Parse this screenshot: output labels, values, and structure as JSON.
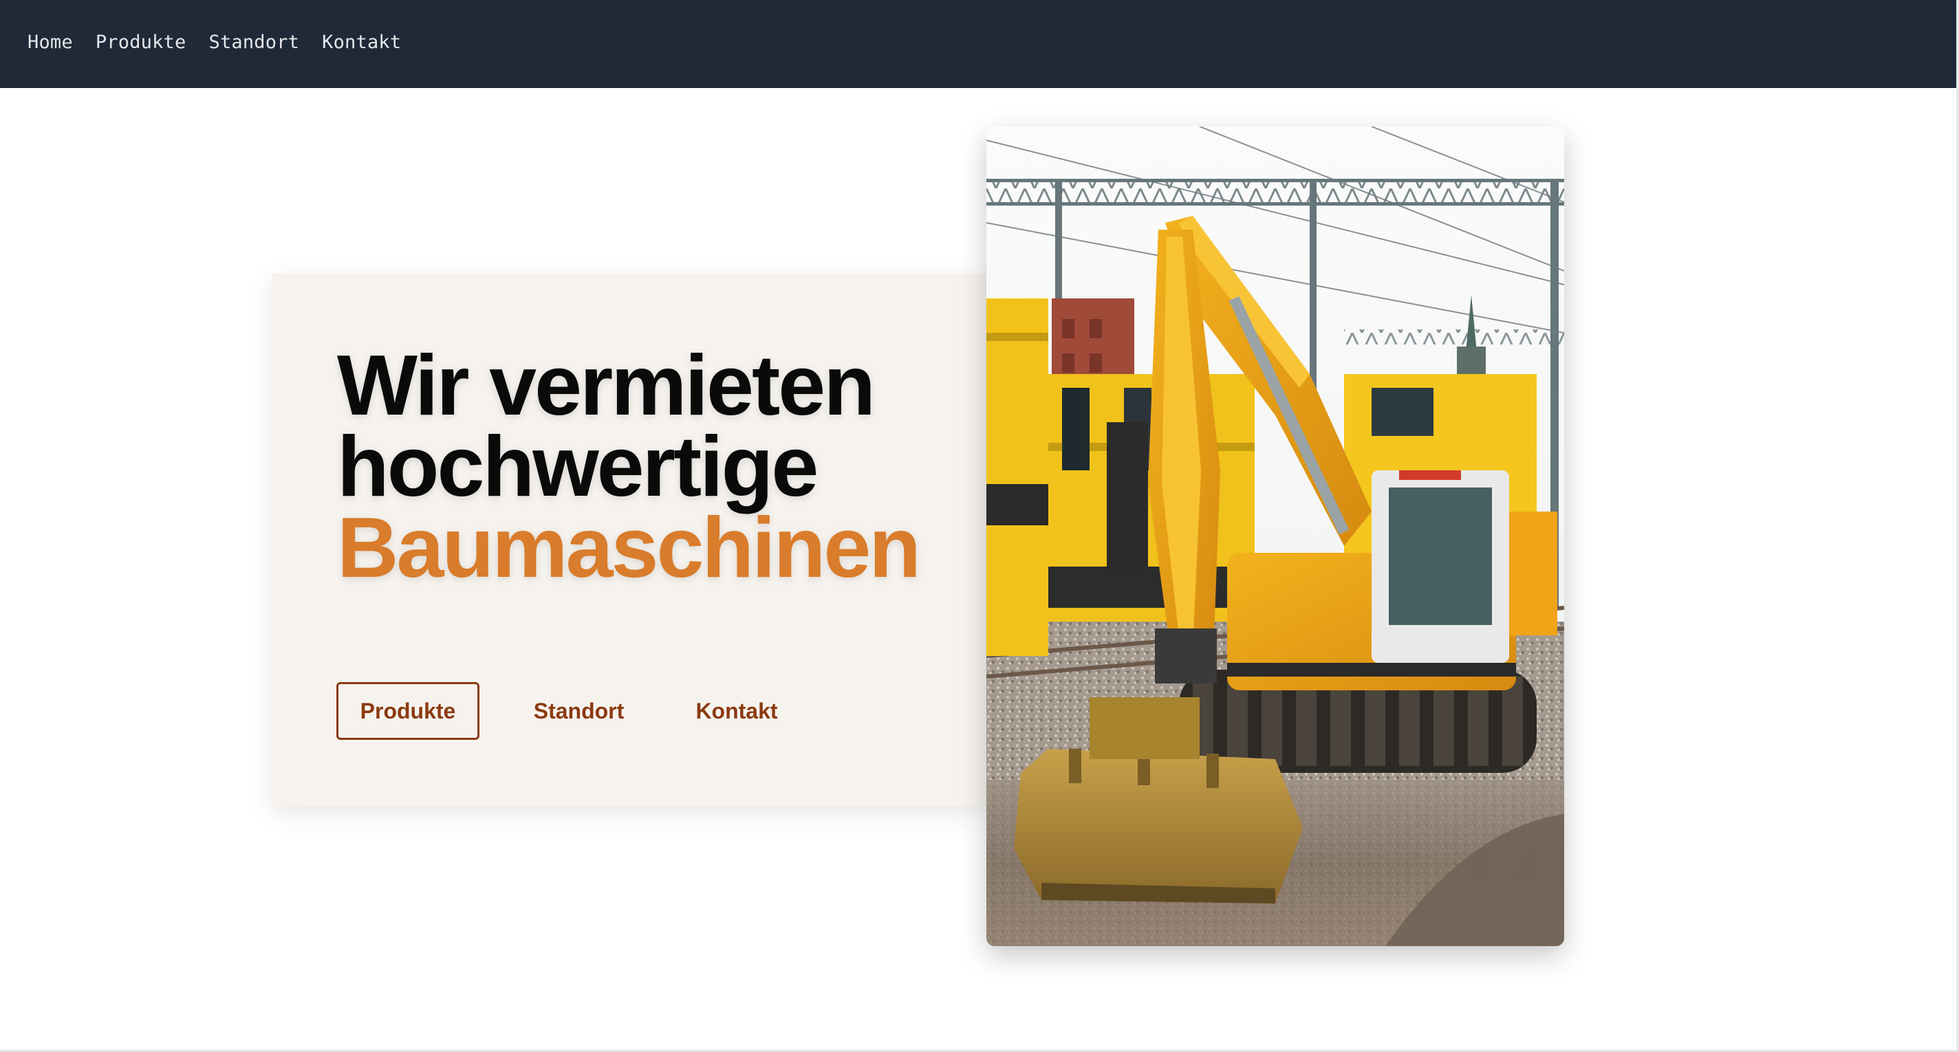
{
  "nav": {
    "items": [
      {
        "label": "Home"
      },
      {
        "label": "Produkte"
      },
      {
        "label": "Standort"
      },
      {
        "label": "Kontakt"
      }
    ]
  },
  "hero": {
    "title_line1": "Wir vermieten",
    "title_line2": "hochwertige",
    "title_accent": "Baumaschinen",
    "buttons": [
      {
        "label": "Produkte"
      },
      {
        "label": "Standort"
      },
      {
        "label": "Kontakt"
      }
    ],
    "image_subject": "yellow-excavator-at-railway-site"
  },
  "colors": {
    "navbar_bg": "#1f2937",
    "accent": "#d97c2b",
    "button_text": "#8b3a10",
    "card_bg": "#f6f3ee"
  }
}
